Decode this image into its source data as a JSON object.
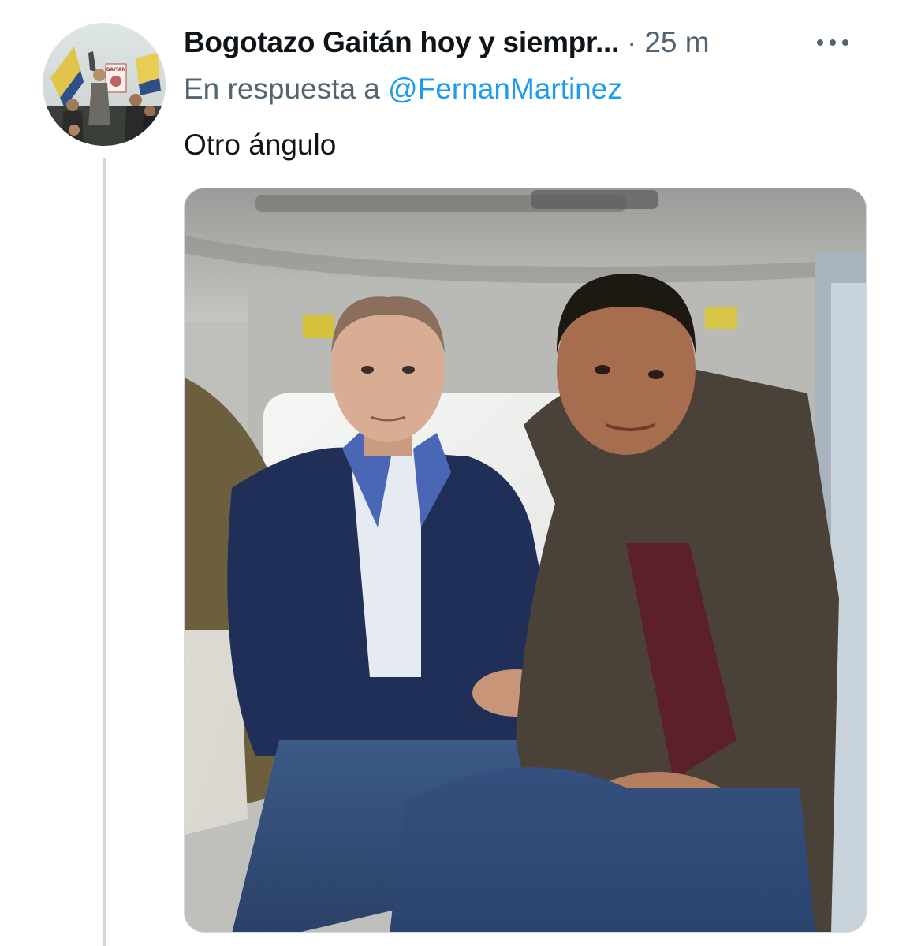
{
  "tweet": {
    "author_name": "Bogotazo Gaitán hoy y siempr...",
    "separator": "·",
    "timestamp": "25 m",
    "more_icon": "ellipsis-horizontal-icon",
    "reply_prefix": "En respuesta a ",
    "reply_to": "@FernanMartinez",
    "text": "Otro ángulo"
  },
  "avatar": {
    "poster_text": "GAITAN"
  },
  "colors": {
    "primary_text": "#0f1419",
    "secondary_text": "#536471",
    "link": "#1d9bf0",
    "thread_line": "#cfd9de"
  }
}
